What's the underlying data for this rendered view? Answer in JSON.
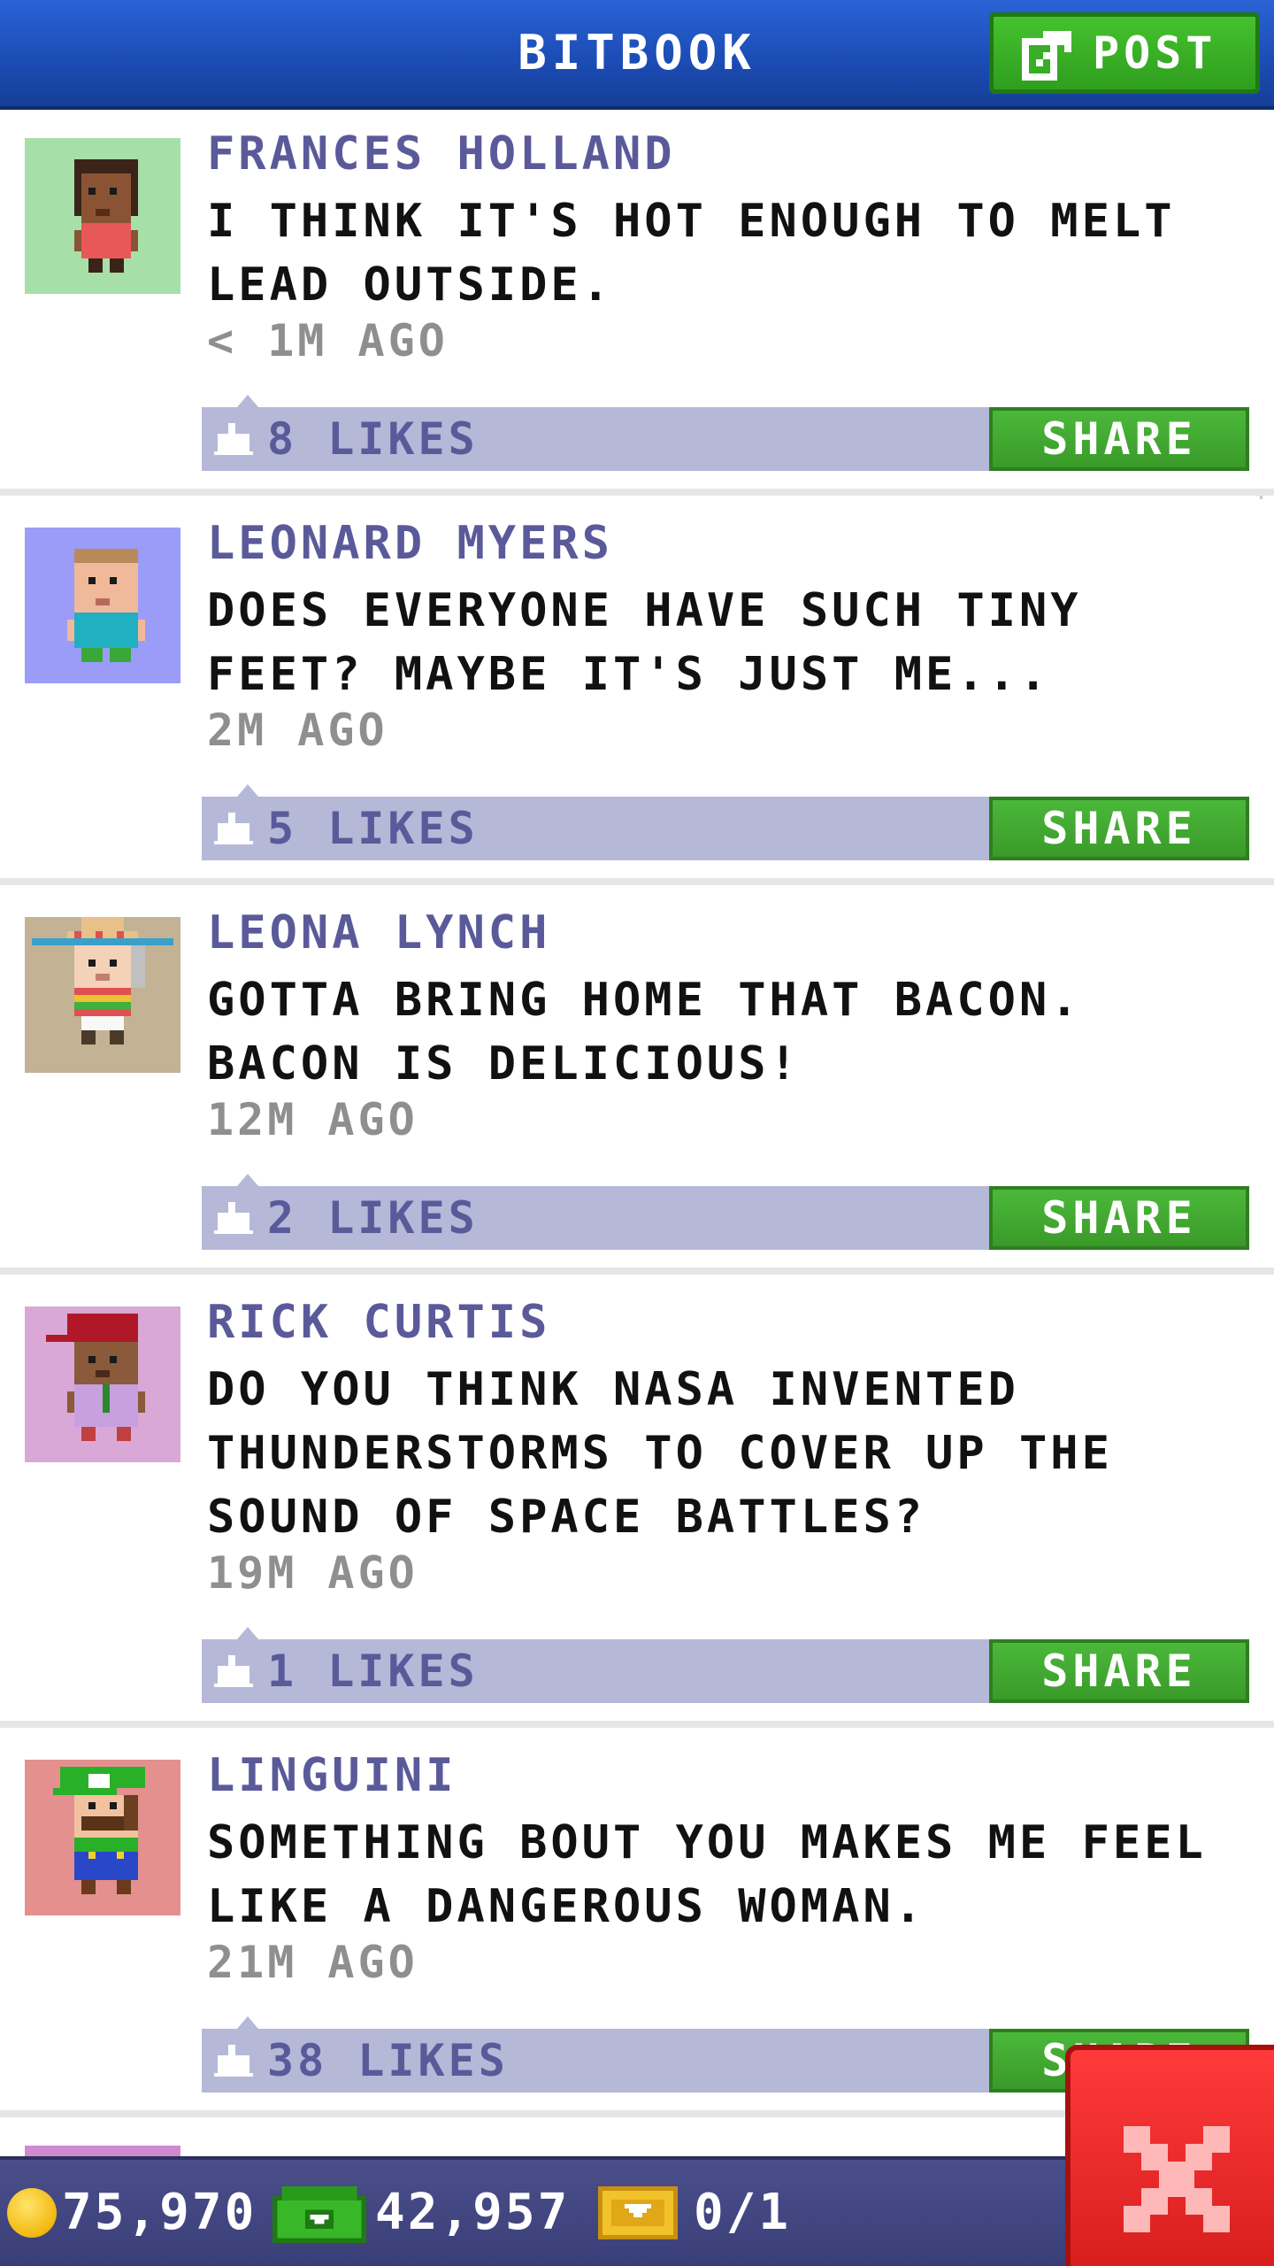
{
  "header": {
    "title": "BITBOOK",
    "post_label": "POST"
  },
  "posts": [
    {
      "author": "FRANCES HOLLAND",
      "message": "I THINK IT'S HOT ENOUGH TO MELT LEAD OUTSIDE.",
      "time": "< 1M AGO",
      "likes": "8 LIKES",
      "share_label": "SHARE",
      "avatar_bg": "#a6e0a8"
    },
    {
      "author": "LEONARD MYERS",
      "message": "DOES EVERYONE HAVE SUCH TINY FEET? MAYBE IT'S JUST ME...",
      "time": "2M AGO",
      "likes": "5 LIKES",
      "share_label": "SHARE",
      "avatar_bg": "#9a9cf8"
    },
    {
      "author": "LEONA LYNCH",
      "message": "GOTTA BRING HOME THAT BACON. BACON IS DELICIOUS!",
      "time": "12M AGO",
      "likes": "2 LIKES",
      "share_label": "SHARE",
      "avatar_bg": "#c3b294"
    },
    {
      "author": "RICK CURTIS",
      "message": "DO YOU THINK NASA INVENTED THUNDERSTORMS TO COVER UP THE SOUND OF SPACE BATTLES?",
      "time": "19M AGO",
      "likes": "1 LIKES",
      "share_label": "SHARE",
      "avatar_bg": "#d9a8d6"
    },
    {
      "author": "LINGUINI",
      "message": "SOMETHING BOUT YOU MAKES ME FEEL LIKE A DANGEROUS WOMAN.",
      "time": "21M AGO",
      "likes": "38 LIKES",
      "share_label": "SHARE",
      "avatar_bg": "#e3908e"
    }
  ],
  "bottom_bar": {
    "coins": "75,970",
    "bux": "42,957",
    "tickets": "0/1"
  },
  "colors": {
    "header_blue": "#1c4db6",
    "like_bar": "#b6b8d8",
    "share_green": "#3a9a29",
    "close_red": "#d81e1e"
  },
  "icons": {
    "post": "compose-icon",
    "like": "thumbs-up-icon",
    "coin": "coin-icon",
    "bux": "cash-icon",
    "ticket": "ticket-icon",
    "close": "close-icon"
  }
}
